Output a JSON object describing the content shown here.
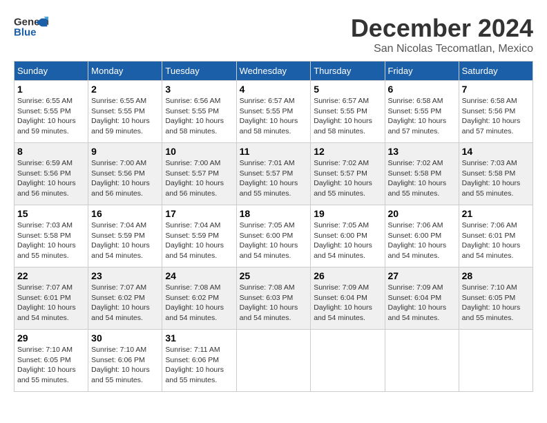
{
  "header": {
    "logo_line1": "General",
    "logo_line2": "Blue",
    "month": "December 2024",
    "location": "San Nicolas Tecomatlan, Mexico"
  },
  "weekdays": [
    "Sunday",
    "Monday",
    "Tuesday",
    "Wednesday",
    "Thursday",
    "Friday",
    "Saturday"
  ],
  "weeks": [
    [
      {
        "day": "1",
        "info": "Sunrise: 6:55 AM\nSunset: 5:55 PM\nDaylight: 10 hours\nand 59 minutes."
      },
      {
        "day": "2",
        "info": "Sunrise: 6:55 AM\nSunset: 5:55 PM\nDaylight: 10 hours\nand 59 minutes."
      },
      {
        "day": "3",
        "info": "Sunrise: 6:56 AM\nSunset: 5:55 PM\nDaylight: 10 hours\nand 58 minutes."
      },
      {
        "day": "4",
        "info": "Sunrise: 6:57 AM\nSunset: 5:55 PM\nDaylight: 10 hours\nand 58 minutes."
      },
      {
        "day": "5",
        "info": "Sunrise: 6:57 AM\nSunset: 5:55 PM\nDaylight: 10 hours\nand 58 minutes."
      },
      {
        "day": "6",
        "info": "Sunrise: 6:58 AM\nSunset: 5:55 PM\nDaylight: 10 hours\nand 57 minutes."
      },
      {
        "day": "7",
        "info": "Sunrise: 6:58 AM\nSunset: 5:56 PM\nDaylight: 10 hours\nand 57 minutes."
      }
    ],
    [
      {
        "day": "8",
        "info": "Sunrise: 6:59 AM\nSunset: 5:56 PM\nDaylight: 10 hours\nand 56 minutes."
      },
      {
        "day": "9",
        "info": "Sunrise: 7:00 AM\nSunset: 5:56 PM\nDaylight: 10 hours\nand 56 minutes."
      },
      {
        "day": "10",
        "info": "Sunrise: 7:00 AM\nSunset: 5:57 PM\nDaylight: 10 hours\nand 56 minutes."
      },
      {
        "day": "11",
        "info": "Sunrise: 7:01 AM\nSunset: 5:57 PM\nDaylight: 10 hours\nand 55 minutes."
      },
      {
        "day": "12",
        "info": "Sunrise: 7:02 AM\nSunset: 5:57 PM\nDaylight: 10 hours\nand 55 minutes."
      },
      {
        "day": "13",
        "info": "Sunrise: 7:02 AM\nSunset: 5:58 PM\nDaylight: 10 hours\nand 55 minutes."
      },
      {
        "day": "14",
        "info": "Sunrise: 7:03 AM\nSunset: 5:58 PM\nDaylight: 10 hours\nand 55 minutes."
      }
    ],
    [
      {
        "day": "15",
        "info": "Sunrise: 7:03 AM\nSunset: 5:58 PM\nDaylight: 10 hours\nand 55 minutes."
      },
      {
        "day": "16",
        "info": "Sunrise: 7:04 AM\nSunset: 5:59 PM\nDaylight: 10 hours\nand 54 minutes."
      },
      {
        "day": "17",
        "info": "Sunrise: 7:04 AM\nSunset: 5:59 PM\nDaylight: 10 hours\nand 54 minutes."
      },
      {
        "day": "18",
        "info": "Sunrise: 7:05 AM\nSunset: 6:00 PM\nDaylight: 10 hours\nand 54 minutes."
      },
      {
        "day": "19",
        "info": "Sunrise: 7:05 AM\nSunset: 6:00 PM\nDaylight: 10 hours\nand 54 minutes."
      },
      {
        "day": "20",
        "info": "Sunrise: 7:06 AM\nSunset: 6:00 PM\nDaylight: 10 hours\nand 54 minutes."
      },
      {
        "day": "21",
        "info": "Sunrise: 7:06 AM\nSunset: 6:01 PM\nDaylight: 10 hours\nand 54 minutes."
      }
    ],
    [
      {
        "day": "22",
        "info": "Sunrise: 7:07 AM\nSunset: 6:01 PM\nDaylight: 10 hours\nand 54 minutes."
      },
      {
        "day": "23",
        "info": "Sunrise: 7:07 AM\nSunset: 6:02 PM\nDaylight: 10 hours\nand 54 minutes."
      },
      {
        "day": "24",
        "info": "Sunrise: 7:08 AM\nSunset: 6:02 PM\nDaylight: 10 hours\nand 54 minutes."
      },
      {
        "day": "25",
        "info": "Sunrise: 7:08 AM\nSunset: 6:03 PM\nDaylight: 10 hours\nand 54 minutes."
      },
      {
        "day": "26",
        "info": "Sunrise: 7:09 AM\nSunset: 6:04 PM\nDaylight: 10 hours\nand 54 minutes."
      },
      {
        "day": "27",
        "info": "Sunrise: 7:09 AM\nSunset: 6:04 PM\nDaylight: 10 hours\nand 54 minutes."
      },
      {
        "day": "28",
        "info": "Sunrise: 7:10 AM\nSunset: 6:05 PM\nDaylight: 10 hours\nand 55 minutes."
      }
    ],
    [
      {
        "day": "29",
        "info": "Sunrise: 7:10 AM\nSunset: 6:05 PM\nDaylight: 10 hours\nand 55 minutes."
      },
      {
        "day": "30",
        "info": "Sunrise: 7:10 AM\nSunset: 6:06 PM\nDaylight: 10 hours\nand 55 minutes."
      },
      {
        "day": "31",
        "info": "Sunrise: 7:11 AM\nSunset: 6:06 PM\nDaylight: 10 hours\nand 55 minutes."
      },
      null,
      null,
      null,
      null
    ]
  ]
}
